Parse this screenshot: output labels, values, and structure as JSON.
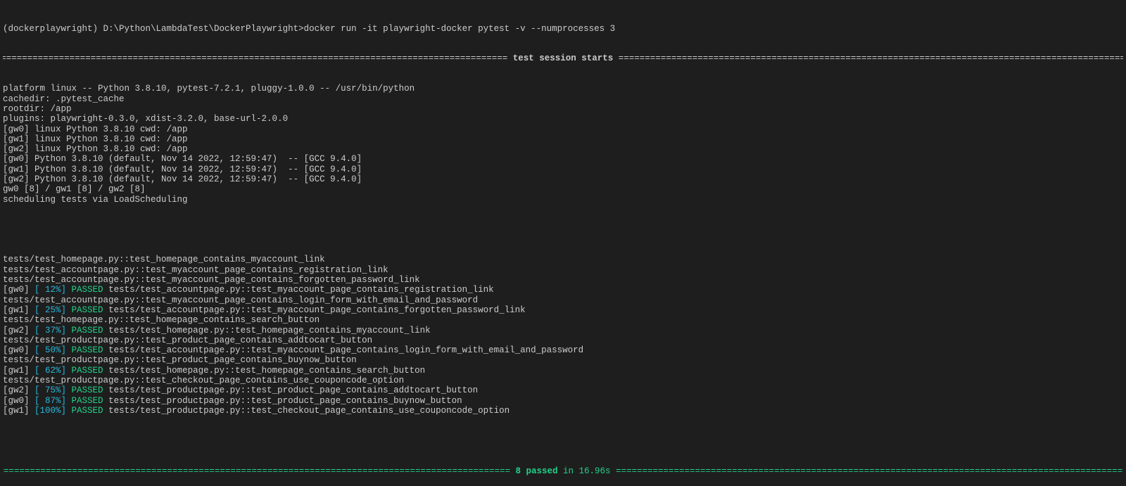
{
  "command_line": "(dockerplaywright) D:\\Python\\LambdaTest\\DockerPlaywright>docker run -it playwright-docker pytest -v --numprocesses 3",
  "session_header": "test session starts",
  "info_lines": [
    "platform linux -- Python 3.8.10, pytest-7.2.1, pluggy-1.0.0 -- /usr/bin/python",
    "cachedir: .pytest_cache",
    "rootdir: /app",
    "plugins: playwright-0.3.0, xdist-3.2.0, base-url-2.0.0",
    "[gw0] linux Python 3.8.10 cwd: /app",
    "[gw1] linux Python 3.8.10 cwd: /app",
    "[gw2] linux Python 3.8.10 cwd: /app",
    "[gw0] Python 3.8.10 (default, Nov 14 2022, 12:59:47)  -- [GCC 9.4.0]",
    "[gw1] Python 3.8.10 (default, Nov 14 2022, 12:59:47)  -- [GCC 9.4.0]",
    "[gw2] Python 3.8.10 (default, Nov 14 2022, 12:59:47)  -- [GCC 9.4.0]",
    "gw0 [8] / gw1 [8] / gw2 [8]",
    "scheduling tests via LoadScheduling"
  ],
  "test_lines": [
    {
      "text": "tests/test_homepage.py::test_homepage_contains_myaccount_link"
    },
    {
      "text": "tests/test_accountpage.py::test_myaccount_page_contains_registration_link"
    },
    {
      "text": "tests/test_accountpage.py::test_myaccount_page_contains_forgotten_password_link"
    },
    {
      "worker": "[gw0] ",
      "percent": "[ 12%]",
      "status": "PASSED",
      "text": "tests/test_accountpage.py::test_myaccount_page_contains_registration_link"
    },
    {
      "text": "tests/test_accountpage.py::test_myaccount_page_contains_login_form_with_email_and_password"
    },
    {
      "worker": "[gw1] ",
      "percent": "[ 25%]",
      "status": "PASSED",
      "text": "tests/test_accountpage.py::test_myaccount_page_contains_forgotten_password_link"
    },
    {
      "text": "tests/test_homepage.py::test_homepage_contains_search_button"
    },
    {
      "worker": "[gw2] ",
      "percent": "[ 37%]",
      "status": "PASSED",
      "text": "tests/test_homepage.py::test_homepage_contains_myaccount_link"
    },
    {
      "text": "tests/test_productpage.py::test_product_page_contains_addtocart_button"
    },
    {
      "worker": "[gw0] ",
      "percent": "[ 50%]",
      "status": "PASSED",
      "text": "tests/test_accountpage.py::test_myaccount_page_contains_login_form_with_email_and_password"
    },
    {
      "text": "tests/test_productpage.py::test_product_page_contains_buynow_button"
    },
    {
      "worker": "[gw1] ",
      "percent": "[ 62%]",
      "status": "PASSED",
      "text": "tests/test_homepage.py::test_homepage_contains_search_button"
    },
    {
      "text": "tests/test_productpage.py::test_checkout_page_contains_use_couponcode_option"
    },
    {
      "worker": "[gw2] ",
      "percent": "[ 75%]",
      "status": "PASSED",
      "text": "tests/test_productpage.py::test_product_page_contains_addtocart_button"
    },
    {
      "worker": "[gw0] ",
      "percent": "[ 87%]",
      "status": "PASSED",
      "text": "tests/test_productpage.py::test_product_page_contains_buynow_button"
    },
    {
      "worker": "[gw1] ",
      "percent": "[100%]",
      "status": "PASSED",
      "text": "tests/test_productpage.py::test_checkout_page_contains_use_couponcode_option"
    }
  ],
  "summary": {
    "passed": "8 passed",
    "duration": " in 16.96s"
  },
  "colors": {
    "background": "#1e1e1e",
    "text": "#cccccc",
    "passed": "#23d18b",
    "percent": "#29b8db"
  }
}
